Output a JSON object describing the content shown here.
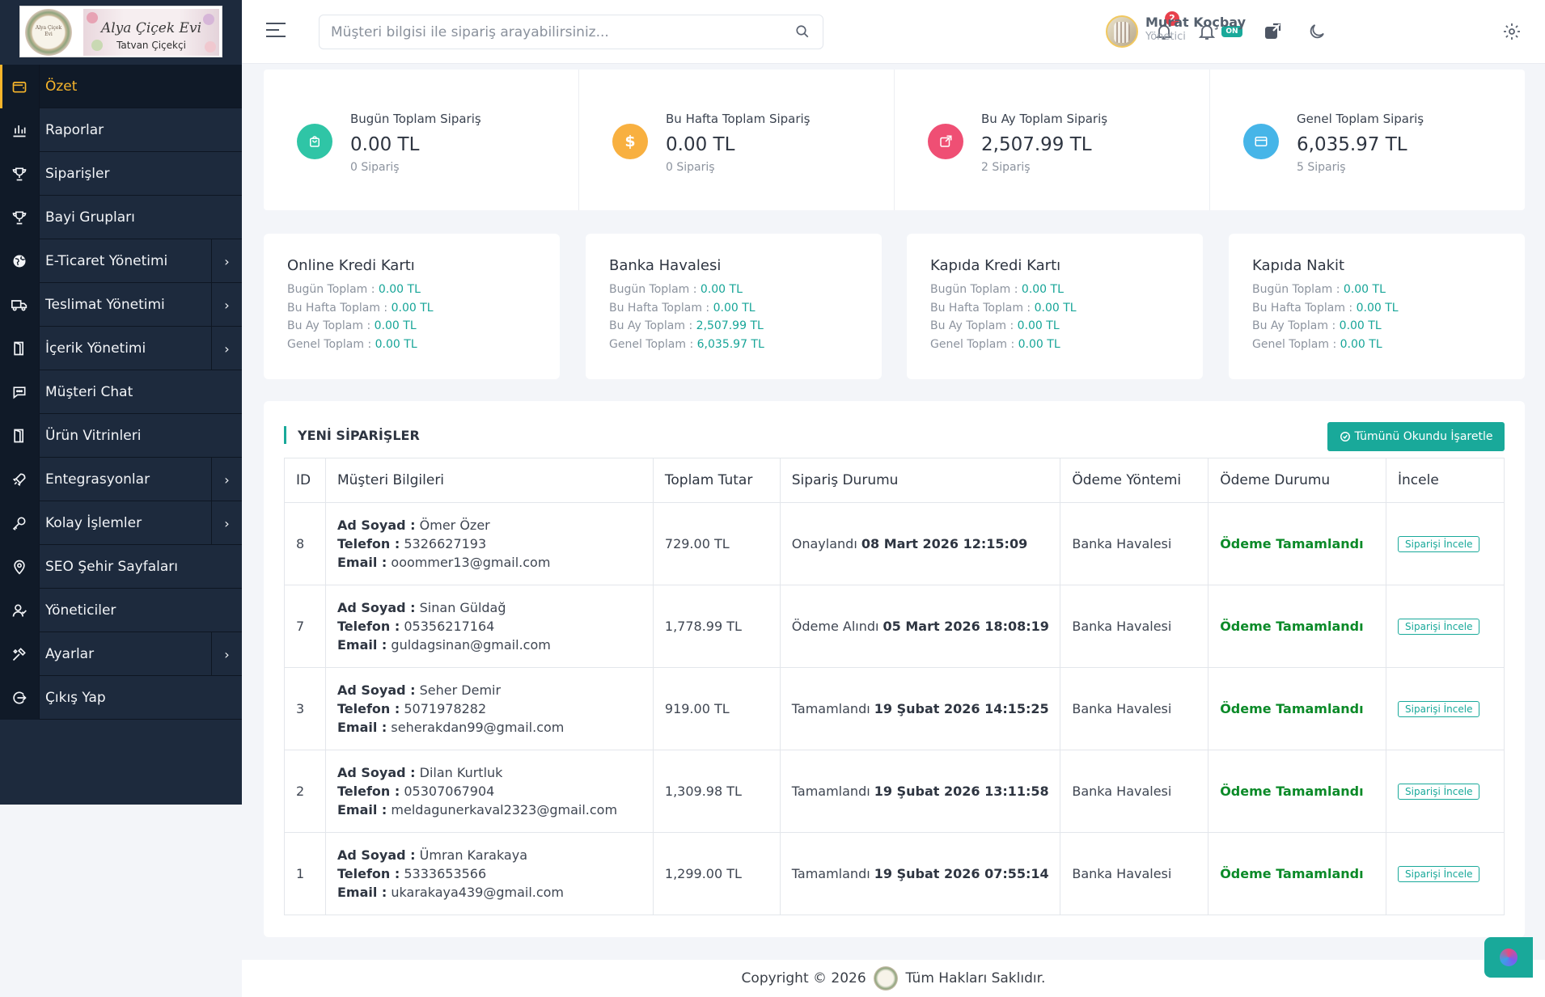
{
  "brand": {
    "title": "Alya Çiçek Evi",
    "subtitle": "Tatvan Çiçekçi"
  },
  "sidebar": {
    "items": [
      {
        "label": "Özet",
        "icon": "wallet-icon",
        "active": true,
        "has_arrow": false
      },
      {
        "label": "Raporlar",
        "icon": "bar-chart-icon",
        "has_arrow": false
      },
      {
        "label": "Siparişler",
        "icon": "trophy-icon",
        "has_arrow": false
      },
      {
        "label": "Bayi Grupları",
        "icon": "trophy-icon",
        "has_arrow": false
      },
      {
        "label": "E-Ticaret Yönetimi",
        "icon": "globe-icon",
        "has_arrow": true
      },
      {
        "label": "Teslimat Yönetimi",
        "icon": "truck-icon",
        "has_arrow": true
      },
      {
        "label": "İçerik Yönetimi",
        "icon": "door-icon",
        "has_arrow": true
      },
      {
        "label": "Müşteri Chat",
        "icon": "chat-icon",
        "has_arrow": false
      },
      {
        "label": "Ürün Vitrinleri",
        "icon": "door-icon",
        "has_arrow": false
      },
      {
        "label": "Entegrasyonlar",
        "icon": "rocket-icon",
        "has_arrow": true
      },
      {
        "label": "Kolay İşlemler",
        "icon": "key-icon",
        "has_arrow": true
      },
      {
        "label": "SEO Şehir Sayfaları",
        "icon": "location-pin-icon",
        "has_arrow": false
      },
      {
        "label": "Yöneticiler",
        "icon": "users-icon",
        "has_arrow": false
      },
      {
        "label": "Ayarlar",
        "icon": "tools-icon",
        "has_arrow": true
      },
      {
        "label": "Çıkış Yap",
        "icon": "logout-icon",
        "has_arrow": false
      }
    ]
  },
  "header": {
    "search_placeholder": "Müşteri bilgisi ile sipariş arayabilirsiniz...",
    "notification_count": "2",
    "on_badge": "ON",
    "user_name": "Murat Koçbay",
    "user_role": "Yönetici"
  },
  "stats": [
    {
      "label": "Bugün Toplam Sipariş",
      "value": "0.00 TL",
      "count": "0 Sipariş",
      "icon": "shopping-bag-icon",
      "color": "#2fc5a6"
    },
    {
      "label": "Bu Hafta Toplam Sipariş",
      "value": "0.00 TL",
      "count": "0 Sipariş",
      "icon": "dollar-icon",
      "color": "#f8b040"
    },
    {
      "label": "Bu Ay Toplam Sipariş",
      "value": "2,507.99 TL",
      "count": "2 Sipariş",
      "icon": "external-link-icon",
      "color": "#ef4f74"
    },
    {
      "label": "Genel Toplam Sipariş",
      "value": "6,035.97 TL",
      "count": "5 Sipariş",
      "icon": "credit-card-icon",
      "color": "#46b5e8"
    }
  ],
  "payments": [
    {
      "title": "Online Kredi Kartı",
      "rows": [
        {
          "label": "Bugün Toplam :",
          "value": "0.00 TL"
        },
        {
          "label": "Bu Hafta Toplam :",
          "value": "0.00 TL"
        },
        {
          "label": "Bu Ay Toplam :",
          "value": "0.00 TL"
        },
        {
          "label": "Genel Toplam :",
          "value": "0.00 TL"
        }
      ]
    },
    {
      "title": "Banka Havalesi",
      "rows": [
        {
          "label": "Bugün Toplam :",
          "value": "0.00 TL"
        },
        {
          "label": "Bu Hafta Toplam :",
          "value": "0.00 TL"
        },
        {
          "label": "Bu Ay Toplam :",
          "value": "2,507.99 TL"
        },
        {
          "label": "Genel Toplam :",
          "value": "6,035.97 TL"
        }
      ]
    },
    {
      "title": "Kapıda Kredi Kartı",
      "rows": [
        {
          "label": "Bugün Toplam :",
          "value": "0.00 TL"
        },
        {
          "label": "Bu Hafta Toplam :",
          "value": "0.00 TL"
        },
        {
          "label": "Bu Ay Toplam :",
          "value": "0.00 TL"
        },
        {
          "label": "Genel Toplam :",
          "value": "0.00 TL"
        }
      ]
    },
    {
      "title": "Kapıda Nakit",
      "rows": [
        {
          "label": "Bugün Toplam :",
          "value": "0.00 TL"
        },
        {
          "label": "Bu Hafta Toplam :",
          "value": "0.00 TL"
        },
        {
          "label": "Bu Ay Toplam :",
          "value": "0.00 TL"
        },
        {
          "label": "Genel Toplam :",
          "value": "0.00 TL"
        }
      ]
    }
  ],
  "orders": {
    "title": "YENİ SİPARİŞLER",
    "mark_all_label": "Tümünü Okundu İşaretle",
    "columns": [
      "ID",
      "Müşteri Bilgileri",
      "Toplam Tutar",
      "Sipariş Durumu",
      "Ödeme Yöntemi",
      "Ödeme Durumu",
      "İncele"
    ],
    "field_labels": {
      "name": "Ad Soyad :",
      "phone": "Telefon :",
      "email": "Email :"
    },
    "rows": [
      {
        "id": "8",
        "name": "Ömer Özer",
        "phone": "5326627193",
        "email": "ooommer13@gmail.com",
        "total": "729.00 TL",
        "status": "Onaylandı",
        "date": "08 Mart 2026 12:15:09",
        "method": "Banka Havalesi",
        "pay_status": "Ödeme Tamamlandı",
        "action": "Siparişi İncele"
      },
      {
        "id": "7",
        "name": "Sinan Güldağ",
        "phone": "05356217164",
        "email": "guldagsinan@gmail.com",
        "total": "1,778.99 TL",
        "status": "Ödeme Alındı",
        "date": "05 Mart 2026 18:08:19",
        "method": "Banka Havalesi",
        "pay_status": "Ödeme Tamamlandı",
        "action": "Siparişi İncele"
      },
      {
        "id": "3",
        "name": "Seher Demir",
        "phone": "5071978282",
        "email": "seherakdan99@gmail.com",
        "total": "919.00 TL",
        "status": "Tamamlandı",
        "date": "19 Şubat 2026 14:15:25",
        "method": "Banka Havalesi",
        "pay_status": "Ödeme Tamamlandı",
        "action": "Siparişi İncele"
      },
      {
        "id": "2",
        "name": "Dilan Kurtluk",
        "phone": "05307067904",
        "email": "meldagunerkaval2323@gmail.com",
        "total": "1,309.98 TL",
        "status": "Tamamlandı",
        "date": "19 Şubat 2026 13:11:58",
        "method": "Banka Havalesi",
        "pay_status": "Ödeme Tamamlandı",
        "action": "Siparişi İncele"
      },
      {
        "id": "1",
        "name": "Ümran Karakaya",
        "phone": "5333653566",
        "email": "ukarakaya439@gmail.com",
        "total": "1,299.00 TL",
        "status": "Tamamlandı",
        "date": "19 Şubat 2026 07:55:14",
        "method": "Banka Havalesi",
        "pay_status": "Ödeme Tamamlandı",
        "action": "Siparişi İncele"
      }
    ]
  },
  "footer": {
    "left": "Copyright © 2026",
    "right": "Tüm Hakları Saklıdır."
  },
  "colors": {
    "sidebar": "#1d2a3d",
    "accent": "#19a99a",
    "active": "#f7b52b",
    "success": "#0b8a28"
  }
}
